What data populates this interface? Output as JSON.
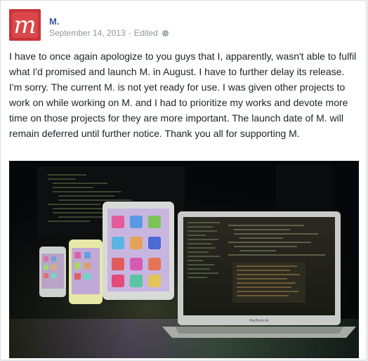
{
  "post": {
    "author_name": "M.",
    "avatar_letter": "m",
    "date": "September 14, 2013",
    "separator": "·",
    "edited_label": "Edited",
    "privacy_icon": "gear-icon",
    "body": "I have to once again apologize to you guys that I, apparently, wasn't able to fulfil what I'd promised and launch M. in August. I have to further delay its release. I'm sorry. The current M. is not yet ready for use. I was given other projects to work on while working on M. and I had to prioritize my works and devote more time on those projects for they are more important. The launch date of M. will remain deferred until further notice. Thank you all for supporting M.",
    "photo": {
      "laptop_label": "MacBook Air"
    }
  },
  "colors": {
    "link": "#3b5998",
    "meta": "#90949c",
    "text": "#1d2129",
    "avatar_bg": "#c7353b"
  }
}
